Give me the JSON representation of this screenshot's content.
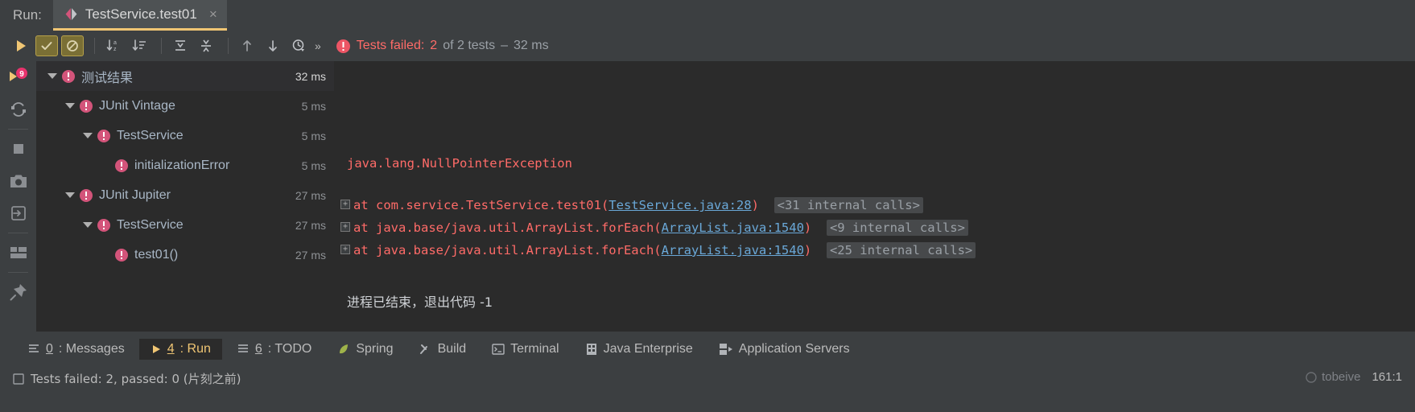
{
  "window": {
    "run_label": "Run:",
    "tab_title": "TestService.test01",
    "tab_close": "×"
  },
  "toolbar": {
    "rerun_label": "Rerun",
    "show_passed_label": "Show Passed",
    "show_ignored_label": "Show Ignored",
    "sort_alpha_label": "Sort Alphabetically",
    "sort_duration_label": "Sort by Duration",
    "expand_all_label": "Expand All",
    "collapse_all_label": "Collapse All",
    "prev_failed_label": "Previous Failed Test",
    "next_failed_label": "Next Failed Test",
    "history_label": "Test History",
    "more_label": "»",
    "status_prefix": "Tests failed:",
    "status_count": "2",
    "status_of": "of 2 tests",
    "status_sep": "–",
    "status_time": "32 ms"
  },
  "left_strip": {
    "items": [
      {
        "icon": "rerun-failed-icon",
        "badge": "9"
      },
      {
        "icon": "rerun-automatically-icon",
        "badge": ""
      },
      {
        "icon": "stop-icon",
        "badge": ""
      },
      {
        "icon": "export-snapshot-icon",
        "badge": ""
      },
      {
        "icon": "import-results-icon",
        "badge": ""
      },
      {
        "icon": "layout-icon",
        "badge": ""
      },
      {
        "icon": "pin-tab-icon",
        "badge": ""
      }
    ]
  },
  "tree": {
    "rows": [
      {
        "label": "测试结果",
        "time": "32 ms",
        "indent": 0,
        "expander": true,
        "selected": true,
        "cjk": true
      },
      {
        "label": "JUnit Vintage",
        "time": "5 ms",
        "indent": 1,
        "expander": true,
        "selected": false,
        "cjk": false
      },
      {
        "label": "TestService",
        "time": "5 ms",
        "indent": 2,
        "expander": true,
        "selected": false,
        "cjk": false
      },
      {
        "label": "initializationError",
        "time": "5 ms",
        "indent": 3,
        "expander": false,
        "selected": false,
        "cjk": false
      },
      {
        "label": "JUnit Jupiter",
        "time": "27 ms",
        "indent": 1,
        "expander": true,
        "selected": false,
        "cjk": false
      },
      {
        "label": "TestService",
        "time": "27 ms",
        "indent": 2,
        "expander": true,
        "selected": false,
        "cjk": false
      },
      {
        "label": "test01()",
        "time": "27 ms",
        "indent": 3,
        "expander": false,
        "selected": false,
        "cjk": false
      }
    ]
  },
  "console": {
    "exception": "java.lang.NullPointerException",
    "frames": [
      {
        "at": "at com.service.TestService.test01(",
        "link": "TestService.java:28",
        "close": ")",
        "internal": "<31 internal calls>"
      },
      {
        "at": "at java.base/java.util.ArrayList.forEach(",
        "link": "ArrayList.java:1540",
        "close": ")",
        "internal": "<9 internal calls>"
      },
      {
        "at": "at java.base/java.util.ArrayList.forEach(",
        "link": "ArrayList.java:1540",
        "close": ")",
        "internal": "<25 internal calls>"
      }
    ],
    "process_exit": "进程已结束，退出代码 -1"
  },
  "bottombar": {
    "items": [
      {
        "mnemonic": "0",
        "label": ": Messages",
        "icon": "messages-icon",
        "active": false
      },
      {
        "mnemonic": "4",
        "label": ": Run",
        "icon": "run-icon",
        "active": true
      },
      {
        "mnemonic": "6",
        "label": ": TODO",
        "icon": "todo-icon",
        "active": false
      },
      {
        "mnemonic": "",
        "label": "Spring",
        "icon": "spring-leaf-icon",
        "active": false
      },
      {
        "mnemonic": "",
        "label": "Build",
        "icon": "build-hammer-icon",
        "active": false
      },
      {
        "mnemonic": "",
        "label": "Terminal",
        "icon": "terminal-icon",
        "active": false
      },
      {
        "mnemonic": "",
        "label": "Java Enterprise",
        "icon": "java-enterprise-icon",
        "active": false
      },
      {
        "mnemonic": "",
        "label": "Application Servers",
        "icon": "application-servers-icon",
        "active": false
      }
    ]
  },
  "statusbar": {
    "message": "Tests failed: 2, passed: 0 (片刻之前)",
    "brand": "tobeive",
    "position": "161:1"
  },
  "colors": {
    "fail_red": "#ff6b68",
    "accent_yellow": "#f0c674",
    "badge_pink": "#d3547a",
    "link_blue": "#6aa8d8",
    "panel_bg": "#3c3f41",
    "content_bg": "#2b2b2b"
  }
}
